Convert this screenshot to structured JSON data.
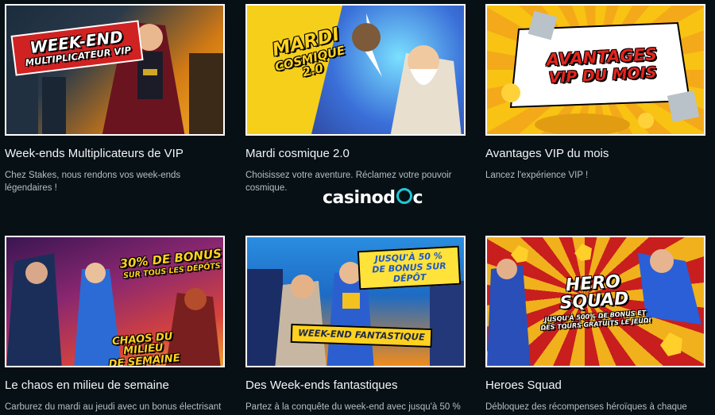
{
  "promotions": [
    {
      "title": "Week-ends Multiplicateurs de VIP",
      "description": "Chez Stakes, nous rendons vos week-ends légendaires !",
      "art_lines": [
        "WEEK-END",
        "MULTIPLICATEUR VIP"
      ]
    },
    {
      "title": "Mardi cosmique 2.0",
      "description": "Choisissez votre aventure. Réclamez votre pouvoir cosmique.",
      "art_lines": [
        "MARDI",
        "COSMIQUE 2.0"
      ]
    },
    {
      "title": "Avantages VIP du mois",
      "description": "Lancez l'expérience VIP !",
      "art_lines": [
        "AVANTAGES",
        "VIP DU MOIS"
      ]
    },
    {
      "title": "Le chaos en milieu de semaine",
      "description": "Carburez du mardi au jeudi avec un bonus électrisant",
      "art_lines": [
        "30% DE BONUS",
        "SUR TOUS LES DÉPÔTS",
        "CHAOS DU MILIEU",
        "DE SEMAINE"
      ]
    },
    {
      "title": "Des Week-ends fantastiques",
      "description": "Partez à la conquête du week-end avec jusqu'à 50 %",
      "art_lines": [
        "JUSQU'À 50 %",
        "DE BONUS SUR",
        "DÉPÔT",
        "WEEK-END FANTASTIQUE"
      ]
    },
    {
      "title": "Heroes Squad",
      "description": "Débloquez des récompenses héroïques à chaque",
      "art_lines": [
        "HERO SQUAD",
        "JUSQU'À 500% DE BONUS ET",
        "DES TOURS GRATUITS LE JEUDI"
      ]
    }
  ],
  "watermark": {
    "part1": "casinod",
    "part2": "c"
  }
}
